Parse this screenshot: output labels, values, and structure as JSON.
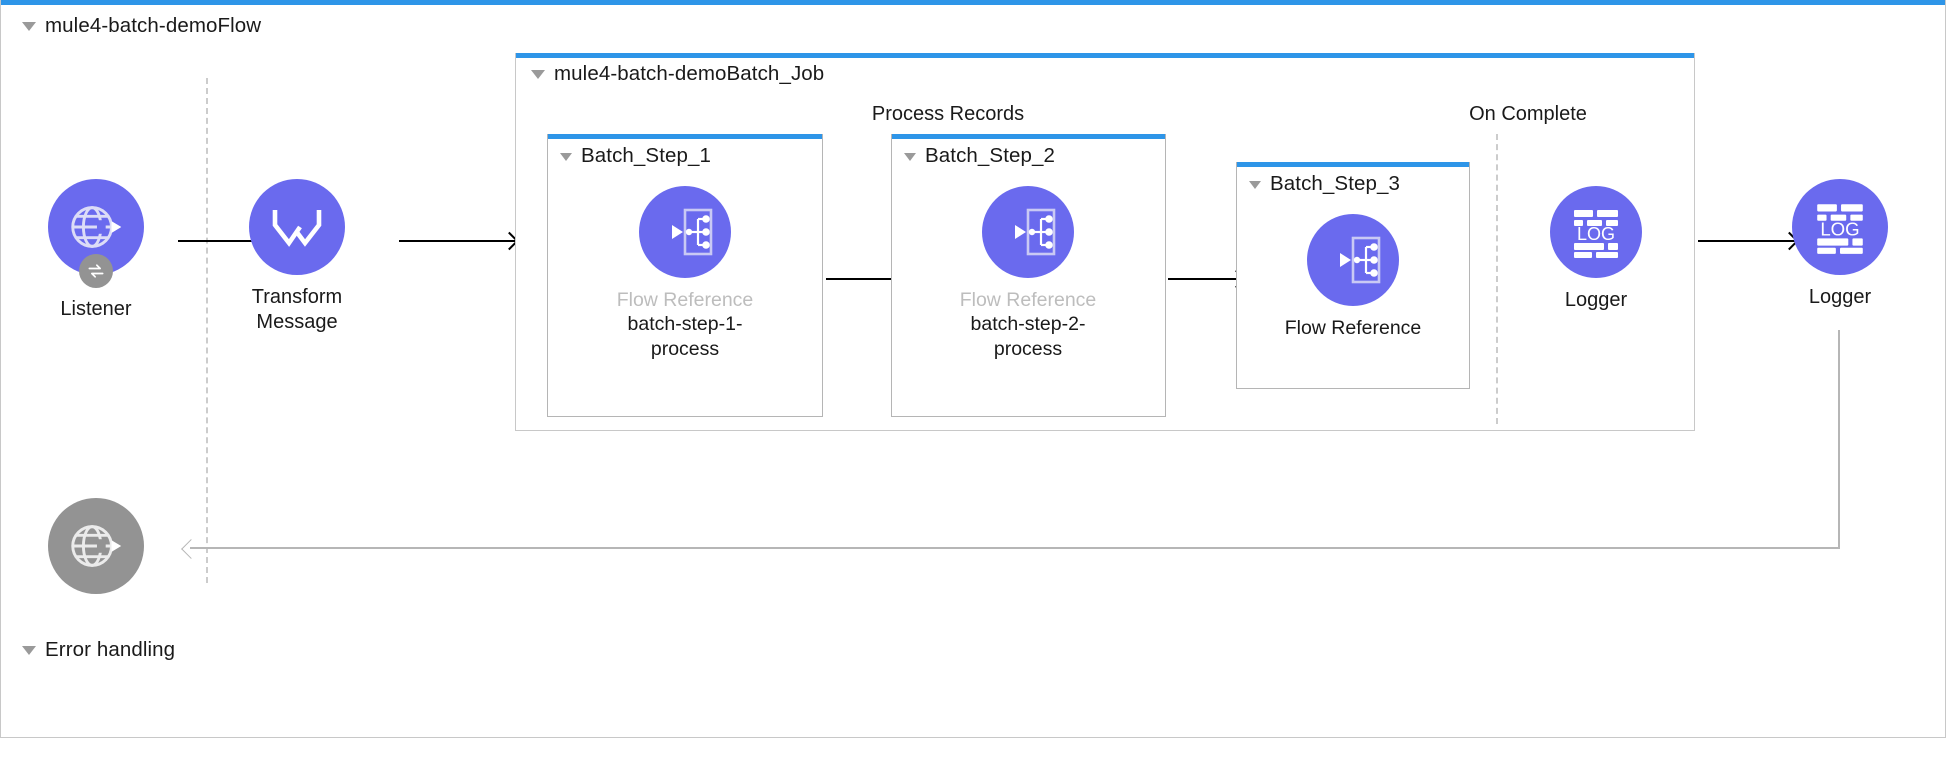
{
  "flow": {
    "title": "mule4-batch-demoFlow",
    "disclosure_icon": "triangle-down-icon"
  },
  "batch_job": {
    "title": "mule4-batch-demoBatch_Job",
    "disclosure_icon": "triangle-down-icon",
    "sections": [
      {
        "caption": "Process Records"
      },
      {
        "caption": "On Complete"
      }
    ],
    "steps": [
      {
        "title": "Batch_Step_1",
        "disclosure_icon": "triangle-down-icon",
        "processor": {
          "icon": "flow-reference-icon",
          "type_label": "Flow Reference",
          "name_label": "batch-step-1-process",
          "type_muted": true
        }
      },
      {
        "title": "Batch_Step_2",
        "disclosure_icon": "triangle-down-icon",
        "processor": {
          "icon": "flow-reference-icon",
          "type_label": "Flow Reference",
          "name_label": "batch-step-2-process",
          "type_muted": true
        }
      },
      {
        "title": "Batch_Step_3",
        "disclosure_icon": "triangle-down-icon",
        "processor": {
          "icon": "flow-reference-icon",
          "type_label": "Flow Reference",
          "name_label": "",
          "type_muted": false
        }
      }
    ]
  },
  "processors": {
    "listener": {
      "icon": "http-globe-icon",
      "badge_icon": "exchange-arrows-icon",
      "label": "Listener"
    },
    "transform": {
      "icon": "dataweave-icon",
      "label": "Transform\nMessage",
      "label_line1": "Transform",
      "label_line2": "Message"
    },
    "on_complete_logger": {
      "icon": "logger-log-icon",
      "label": "Logger",
      "icon_text": "LOG"
    },
    "end_logger": {
      "icon": "logger-log-icon",
      "label": "Logger",
      "icon_text": "LOG"
    },
    "error_source": {
      "icon": "http-globe-icon",
      "label": ""
    }
  },
  "error_handling": {
    "title": "Error handling",
    "disclosure_icon": "triangle-down-icon"
  },
  "colors": {
    "accent_blue": "#2e95e8",
    "processor_purple": "#6a6aee",
    "processor_gray": "#939393",
    "border_gray": "#c8c8c8",
    "muted_text": "#bdbdbd",
    "connector_black": "#000000",
    "return_gray": "#b6b6b6",
    "dashed_gray": "#cccccc"
  }
}
